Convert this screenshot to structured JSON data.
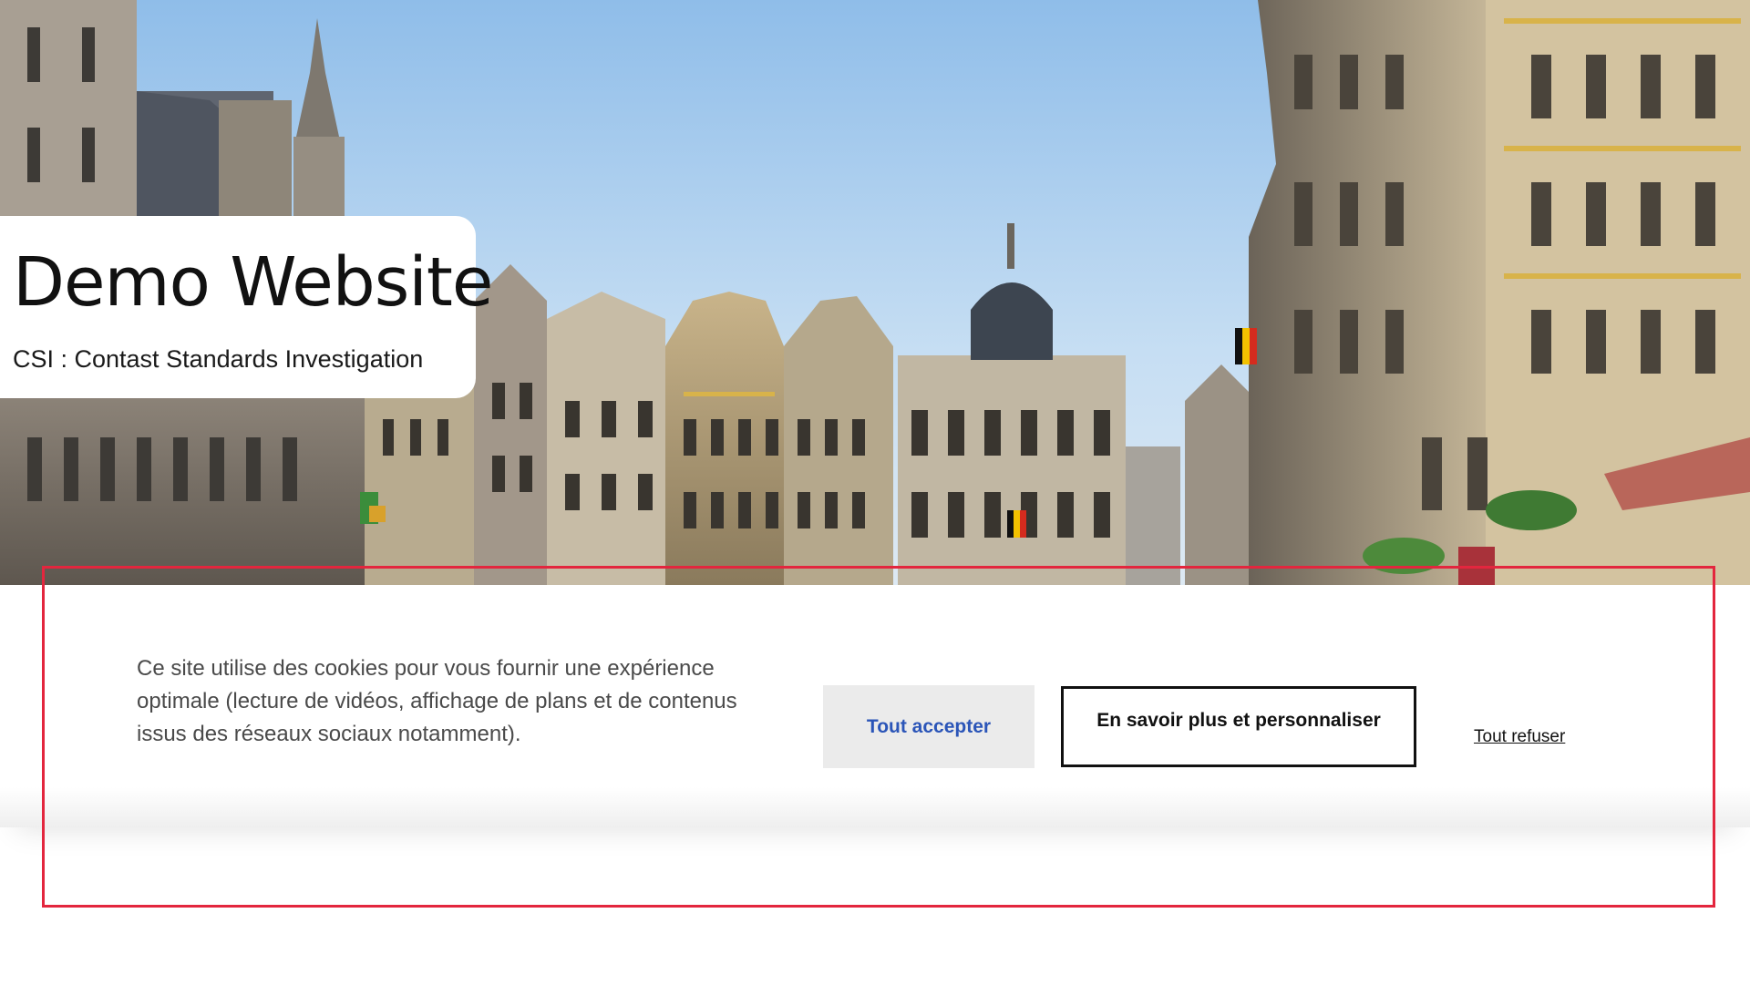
{
  "header": {
    "title": "Demo Website",
    "subtitle": "CSI : Contast Standards Investigation",
    "background_image": "brussels-grand-place-photo"
  },
  "cookie_banner": {
    "message": "Ce site utilise des cookies pour vous fournir une expérience optimale (lecture de vidéos, affichage de plans et de contenus issus des réseaux sociaux notamment).",
    "accept_all_label": "Tout accepter",
    "learn_more_label": "En savoir plus et personnaliser",
    "refuse_all_label": "Tout refuser"
  },
  "colors": {
    "accept_text": "#2b55b8",
    "accept_bg": "#ebebeb",
    "highlight_border": "#e3263e",
    "body_text": "#4a4a4a"
  }
}
